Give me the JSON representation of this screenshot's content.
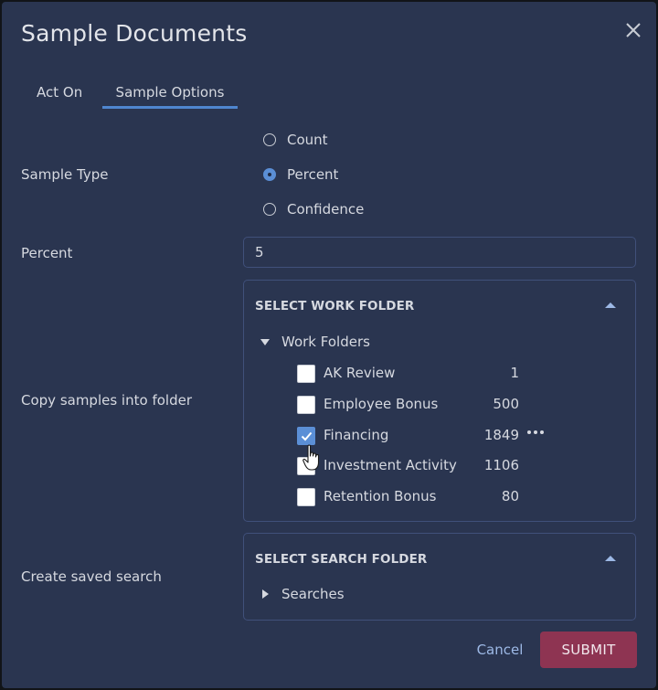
{
  "dialog": {
    "title": "Sample Documents",
    "close_icon": "close-icon"
  },
  "tabs": [
    {
      "label": "Act On",
      "active": false
    },
    {
      "label": "Sample Options",
      "active": true
    }
  ],
  "sample_type": {
    "label": "Sample Type",
    "options": [
      {
        "label": "Count",
        "selected": false
      },
      {
        "label": "Percent",
        "selected": true
      },
      {
        "label": "Confidence",
        "selected": false
      }
    ]
  },
  "percent": {
    "label": "Percent",
    "value": "5"
  },
  "copy_folder": {
    "label": "Copy samples into folder",
    "panel_title": "SELECT WORK FOLDER",
    "root": {
      "label": "Work Folders",
      "expanded": true
    },
    "folders": [
      {
        "name": "AK Review",
        "count": "1",
        "checked": false
      },
      {
        "name": "Employee Bonus",
        "count": "500",
        "checked": false
      },
      {
        "name": "Financing",
        "count": "1849",
        "checked": true,
        "hovered": true
      },
      {
        "name": "Investment Activity",
        "count": "1106",
        "checked": false
      },
      {
        "name": "Retention Bonus",
        "count": "80",
        "checked": false
      }
    ]
  },
  "saved_search": {
    "label": "Create saved search",
    "panel_title": "SELECT SEARCH FOLDER",
    "root": {
      "label": "Searches",
      "expanded": false
    }
  },
  "footer": {
    "cancel_label": "Cancel",
    "submit_label": "SUBMIT"
  },
  "colors": {
    "background": "#2a3550",
    "accent": "#5b8fd6",
    "submit": "#8e3452",
    "link": "#9db9e6"
  }
}
